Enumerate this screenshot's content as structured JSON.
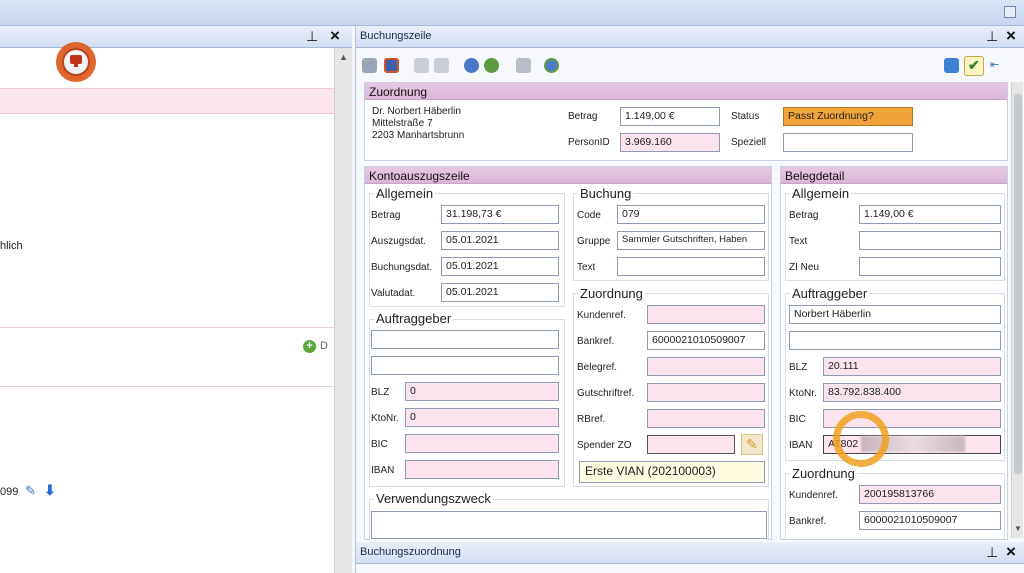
{
  "left_pane": {
    "text_fragment": "hlich",
    "add_label": "D",
    "number_fragment": "099"
  },
  "buchungszeile": {
    "title": "Buchungszeile",
    "zuordnung": {
      "header": "Zuordnung",
      "address_lines": [
        "Dr. Norbert Häberlin",
        "Mittelstraße 7",
        "2203 Manhartsbrunn"
      ],
      "betrag_label": "Betrag",
      "betrag_value": "1.149,00 €",
      "personid_label": "PersonID",
      "personid_value": "3.969.160",
      "status_label": "Status",
      "status_value": "Passt Zuordnung?",
      "speziell_label": "Speziell",
      "speziell_value": ""
    },
    "konto": {
      "header": "Kontoauszugszeile",
      "allgemein": {
        "title": "Allgemein",
        "fields": [
          {
            "label": "Betrag",
            "value": "31.198,73 €"
          },
          {
            "label": "Auszugsdat.",
            "value": "05.01.2021"
          },
          {
            "label": "Buchungsdat.",
            "value": "05.01.2021"
          },
          {
            "label": "Valutadat.",
            "value": "05.01.2021"
          }
        ]
      },
      "auftraggeber": {
        "title": "Auftraggeber",
        "line1": "",
        "line2": "",
        "blz_label": "BLZ",
        "blz_value": "0",
        "ktonr_label": "KtoNr.",
        "ktonr_value": "0",
        "bic_label": "BIC",
        "bic_value": "",
        "iban_label": "IBAN",
        "iban_value": ""
      },
      "buchung": {
        "title": "Buchung",
        "fields": [
          {
            "label": "Code",
            "value": "079"
          },
          {
            "label": "Gruppe",
            "value": "Sammler Gutschriften, Haben"
          },
          {
            "label": "Text",
            "value": ""
          }
        ]
      },
      "zuordnung": {
        "title": "Zuordnung",
        "fields": [
          {
            "label": "Kundenref.",
            "value": ""
          },
          {
            "label": "Bankref.",
            "value": "6000021010509007"
          },
          {
            "label": "Belegref.",
            "value": ""
          },
          {
            "label": "Gutschriftref.",
            "value": ""
          },
          {
            "label": "RBref.",
            "value": ""
          },
          {
            "label": "Spender ZO",
            "value": ""
          }
        ],
        "spender_name": "Erste VIAN (202100003)"
      },
      "verwendungszweck": {
        "title": "Verwendungszweck",
        "value": ""
      }
    },
    "beleg": {
      "header": "Belegdetail",
      "allgemein": {
        "title": "Allgemein",
        "fields": [
          {
            "label": "Betrag",
            "value": "1.149,00 €"
          },
          {
            "label": "Text",
            "value": ""
          },
          {
            "label": "ZI Neu",
            "value": ""
          }
        ]
      },
      "auftraggeber": {
        "title": "Auftraggeber",
        "name": "Norbert Häberlin",
        "line2": "",
        "blz_label": "BLZ",
        "blz_value": "20.111",
        "ktonr_label": "KtoNr.",
        "ktonr_value": "83.792.838.400",
        "bic_label": "BIC",
        "bic_value": "",
        "iban_label": "IBAN",
        "iban_value": "AT802"
      },
      "zuordnung": {
        "title": "Zuordnung",
        "fields": [
          {
            "label": "Kundenref.",
            "value": "200195813766"
          },
          {
            "label": "Bankref.",
            "value": "6000021010509007"
          }
        ]
      }
    }
  },
  "buchungszuordnung": {
    "title": "Buchungszuordnung"
  },
  "colors": {
    "accent_pink": "#dab6d6",
    "status_orange": "#f1a33a",
    "highlight_ring": "#f0a020"
  }
}
